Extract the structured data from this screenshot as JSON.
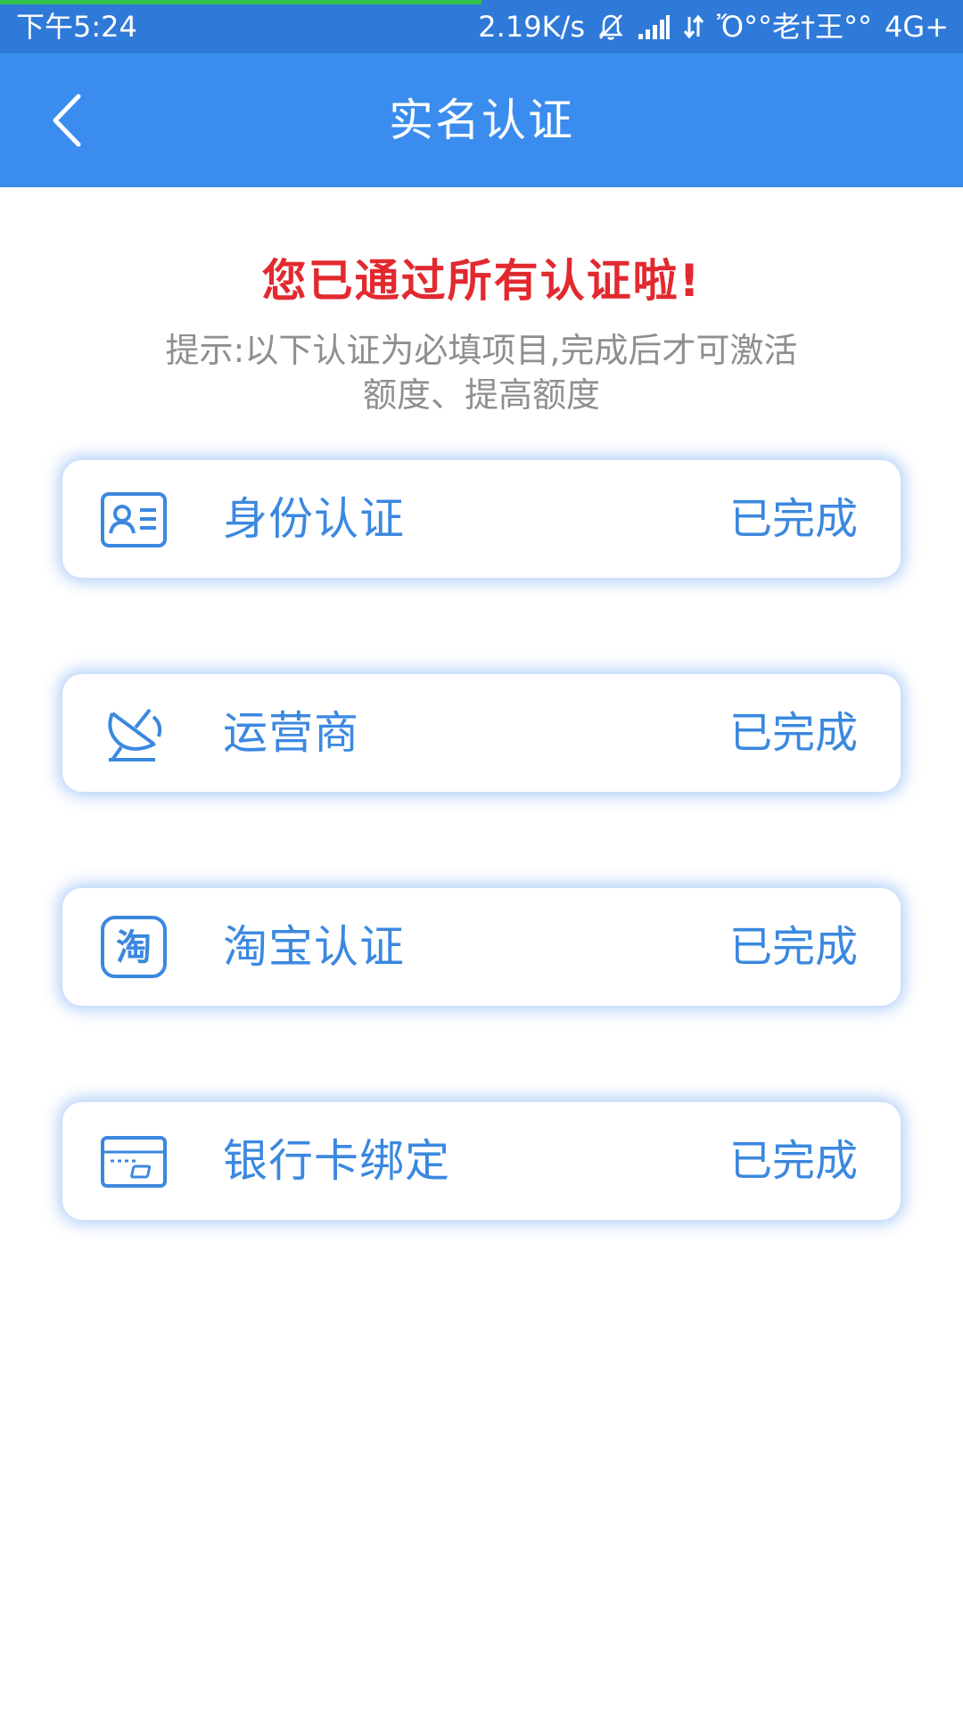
{
  "status_bar": {
    "time": "下午5:24",
    "network_speed": "2.19K/s",
    "carrier": "Ὄ°°老†王°°",
    "network_type": "4G+",
    "icons": [
      "bell-muted-icon",
      "signal-icon",
      "data-arrows-icon"
    ],
    "load_progress": 0.5
  },
  "header": {
    "title": "实名认证",
    "back_icon": "chevron-left-icon"
  },
  "message": {
    "success": "您已通过所有认证啦!",
    "hint_line1": "提示:以下认证为必填项目,完成后才可激活",
    "hint_line2": "额度、提高额度"
  },
  "items": [
    {
      "label": "身份认证",
      "status": "已完成",
      "icon": "id-card-icon"
    },
    {
      "label": "运营商",
      "status": "已完成",
      "icon": "satellite-dish-icon"
    },
    {
      "label": "淘宝认证",
      "status": "已完成",
      "icon": "taobao-icon",
      "icon_text": "淘"
    },
    {
      "label": "银行卡绑定",
      "status": "已完成",
      "icon": "bank-card-icon"
    }
  ],
  "colors": {
    "header_bg": "#3a8dee",
    "status_bar_bg": "#2f7ad8",
    "accent": "#3b88e0",
    "success_text": "#e2292f",
    "hint_text": "#8f8f8f"
  }
}
